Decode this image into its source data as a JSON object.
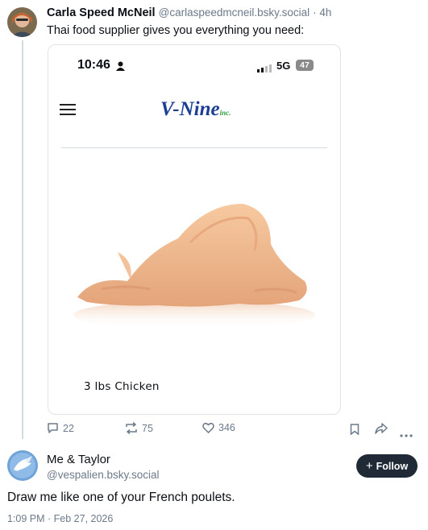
{
  "post1": {
    "author_name": "Carla Speed McNeil",
    "author_handle": "@carlaspeedmcneil.bsky.social",
    "time_ago": "· 4h",
    "text": "Thai food supplier gives you everything you need:",
    "embed": {
      "status_time": "10:46",
      "network": "5G",
      "battery": "47",
      "brand": "V-Nine",
      "brand_suffix": "inc.",
      "caption": "3 lbs Chicken"
    },
    "actions": {
      "replies": "22",
      "reposts": "75",
      "likes": "346"
    }
  },
  "post2": {
    "author_name": "Me & Taylor",
    "author_handle": "@vespalien.bsky.social",
    "follow_label": "Follow",
    "text": "Draw me like one of your French poulets.",
    "timestamp": "1:09 PM · Feb 27, 2026"
  },
  "colors": {
    "brand_green": "#2e9a3c",
    "brand_blue": "#1d3f93",
    "accent": "#1f2a36"
  }
}
